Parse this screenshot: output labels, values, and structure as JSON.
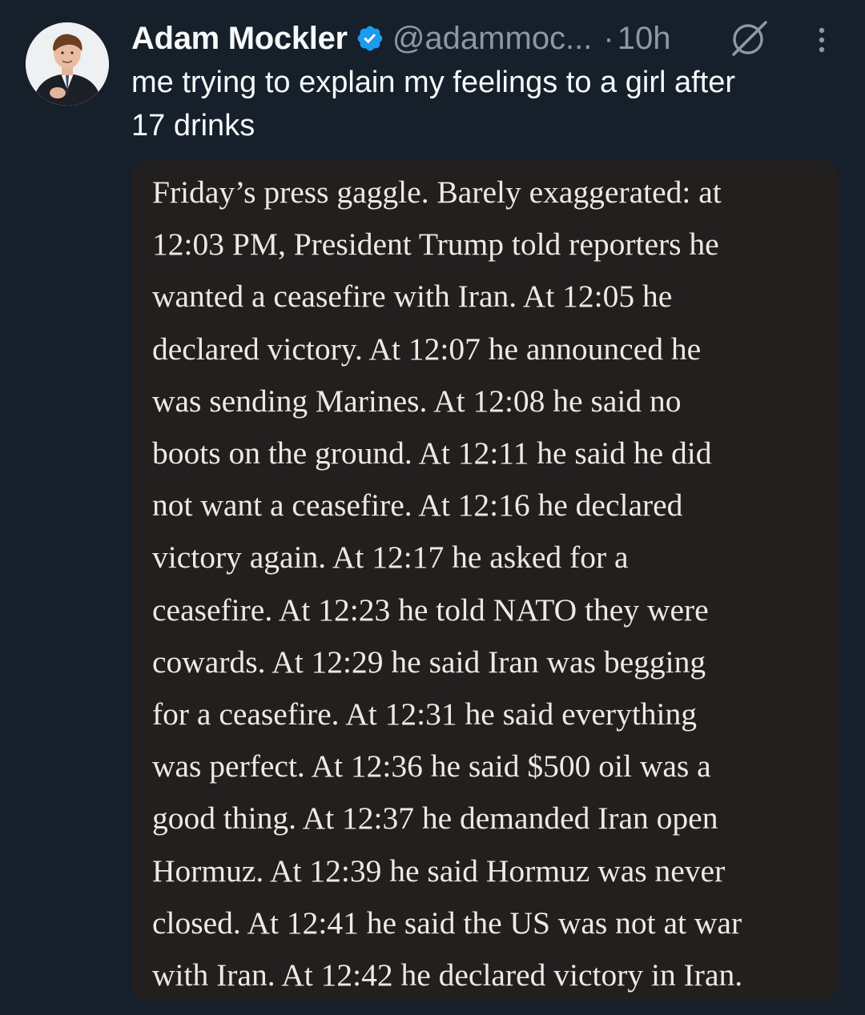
{
  "author": {
    "display_name": "Adam Mockler",
    "handle": "@adammoc...",
    "verified": true,
    "verified_color": "#1d9bf0",
    "avatar_icon": "profile-photo"
  },
  "meta": {
    "separator": "·",
    "time": "10h",
    "grok_icon": "grok-icon",
    "more_icon": "vertical-ellipsis-icon"
  },
  "tweet": {
    "text": "me trying to explain my feelings to a girl after\n17 drinks"
  },
  "media": {
    "background": "#221f1f",
    "lines": [
      "Friday’s press gaggle. Barely exaggerated: at",
      "12:03 PM, President Trump told reporters he",
      "wanted a ceasefire with Iran. At 12:05 he",
      "declared victory. At 12:07 he announced he",
      "was sending Marines. At 12:08 he said no",
      "boots on the ground. At 12:11 he said he did",
      "not want a ceasefire. At 12:16 he declared",
      "victory again. At 12:17 he asked for a",
      "ceasefire. At 12:23 he told NATO they were",
      "cowards. At 12:29 he said Iran was begging",
      "for a ceasefire. At 12:31 he said everything",
      "was perfect. At 12:36 he said $500 oil was a",
      "good thing. At 12:37 he demanded Iran open",
      "Hormuz. At 12:39 he said Hormuz was never",
      "closed. At 12:41 he said the US was not at war",
      "with Iran. At 12:42 he declared victory in Iran."
    ]
  },
  "colors": {
    "background": "#15202b",
    "primary_text": "#f7f9f9",
    "secondary_text": "#8b98a5"
  }
}
